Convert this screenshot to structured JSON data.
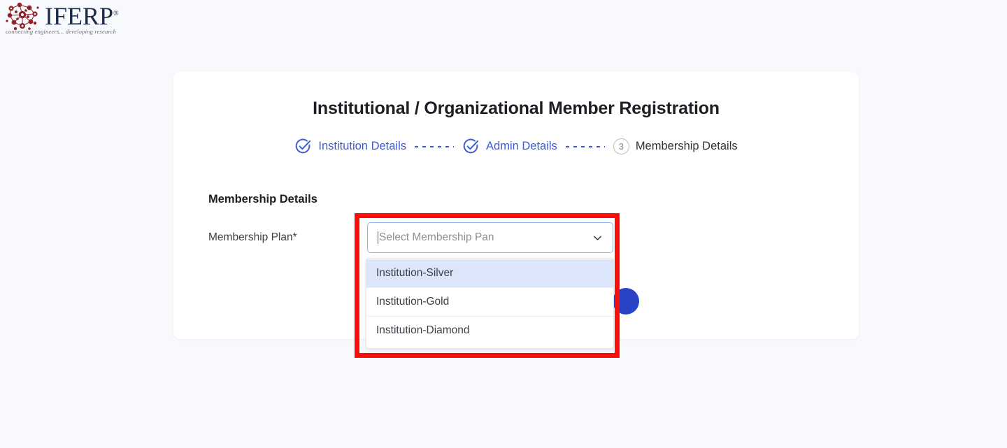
{
  "brand": {
    "name": "IFERP",
    "registered_mark": "®",
    "tagline": "connecting engineers... developing research",
    "logo_icon": "molecule-network-icon",
    "logo_color": "#9b2b2b",
    "wordmark_color": "#1b2a45"
  },
  "page": {
    "background_color": "#f8f9fd"
  },
  "card": {
    "title": "Institutional / Organizational Member Registration",
    "background_color": "#ffffff"
  },
  "stepper": {
    "accent_color": "#3b5bdb",
    "inactive_color": "#8a8f96",
    "steps": [
      {
        "label": "Institution Details",
        "state": "done",
        "icon": "check-circle-icon",
        "number": "1"
      },
      {
        "label": "Admin Details",
        "state": "done",
        "icon": "check-circle-icon",
        "number": "2"
      },
      {
        "label": "Membership Details",
        "state": "current",
        "icon": "number-circle-icon",
        "number": "3"
      }
    ]
  },
  "form": {
    "section_title": "Membership Details",
    "plan_label": "Membership Plan*",
    "plan_select": {
      "value": "",
      "placeholder": "Select Membership Pan",
      "chevron_icon": "chevron-down-icon",
      "focused": true,
      "focus_border_color": "#8fb4e8"
    }
  },
  "dropdown": {
    "open": true,
    "highlight_color": "#dbe6fb",
    "options": [
      {
        "label": "Institution-Silver",
        "highlighted": true
      },
      {
        "label": "Institution-Gold",
        "highlighted": false
      },
      {
        "label": "Institution-Diamond",
        "highlighted": false
      }
    ]
  },
  "round_button": {
    "name": "submit-round-button",
    "color": "#2a42c4",
    "label": ""
  },
  "annotation": {
    "shape": "rectangle",
    "color": "#fc0d08",
    "target": "membership-plan-dropdown"
  }
}
